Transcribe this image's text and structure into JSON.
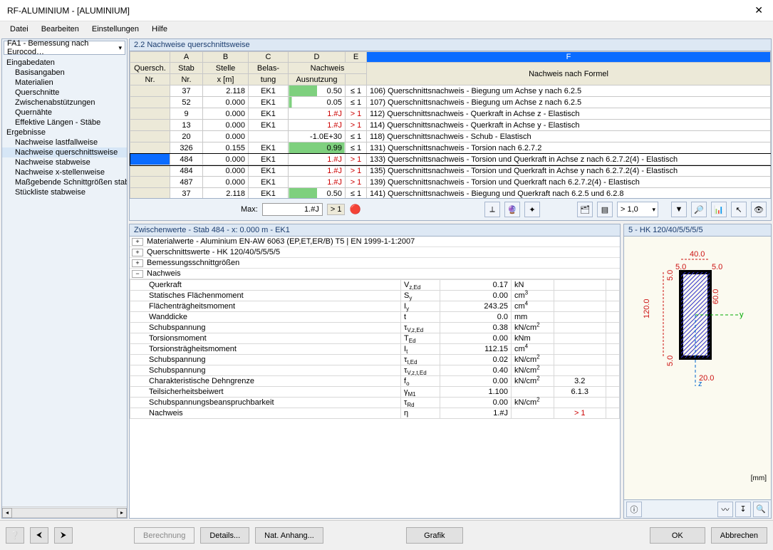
{
  "title": "RF-ALUMINIUM - [ALUMINIUM]",
  "menu": [
    "Datei",
    "Bearbeiten",
    "Einstellungen",
    "Hilfe"
  ],
  "left_dropdown": "FA1 - Bemessung nach Eurocod…",
  "tree": {
    "g1": "Eingabedaten",
    "g1_items": [
      "Basisangaben",
      "Materialien",
      "Querschnitte",
      "Zwischenabstützungen",
      "Quernähte",
      "Effektive Längen - Stäbe"
    ],
    "g2": "Ergebnisse",
    "g2_items": [
      "Nachweise lastfallweise",
      "Nachweise querschnittsweise",
      "Nachweise stabweise",
      "Nachweise x-stellenweise",
      "Maßgebende Schnittgrößen stabweise",
      "Stückliste stabweise"
    ],
    "selected": "Nachweise querschnittsweise"
  },
  "section_title": "2.2 Nachweise querschnittsweise",
  "grid": {
    "letters": [
      "",
      "A",
      "B",
      "C",
      "D",
      "E",
      "F"
    ],
    "headers_l1": [
      "Quersch.",
      "Stab",
      "Stelle",
      "Belas-",
      "Nachweis",
      "",
      "Nachweis nach Formel"
    ],
    "headers_l2": [
      "Nr.",
      "Nr.",
      "x [m]",
      "tung",
      "Ausnutzung",
      "",
      ""
    ],
    "rows": [
      {
        "a": "37",
        "b": "2.118",
        "c": "EK1",
        "d": "0.50",
        "dcls": "prog",
        "e": "≤ 1",
        "f": "106) Querschnittsnachweis - Biegung um Achse y nach 6.2.5"
      },
      {
        "a": "52",
        "b": "0.000",
        "c": "EK1",
        "d": "0.05",
        "dcls": "prog-tiny",
        "e": "≤ 1",
        "f": "107) Querschnittsnachweis - Biegung um Achse z nach 6.2.5"
      },
      {
        "a": "9",
        "b": "0.000",
        "c": "EK1",
        "d": "1.#J",
        "dcls": "red",
        "e": "> 1",
        "ecls": "red",
        "f": "112) Querschnittsnachweis - Querkraft in Achse z - Elastisch"
      },
      {
        "a": "13",
        "b": "0.000",
        "c": "EK1",
        "d": "1.#J",
        "dcls": "red",
        "e": "> 1",
        "ecls": "red",
        "f": "114) Querschnittsnachweis - Querkraft in Achse y - Elastisch"
      },
      {
        "a": "20",
        "b": "0.000",
        "c": "",
        "d": "-1.0E+30",
        "dcls": "",
        "e": "≤ 1",
        "f": "118) Querschnittsnachweis - Schub - Elastisch"
      },
      {
        "a": "326",
        "b": "0.155",
        "c": "EK1",
        "d": "0.99",
        "dcls": "prog-near",
        "e": "≤ 1",
        "f": "131) Querschnittsnachweis - Torsion nach 6.2.7.2"
      },
      {
        "a": "484",
        "b": "0.000",
        "c": "EK1",
        "d": "1.#J",
        "dcls": "red",
        "e": "> 1",
        "ecls": "red",
        "f": "133) Querschnittsnachweis - Torsion und Querkraft in Achse z nach 6.2.7.2(4) - Elastisch",
        "sel": true
      },
      {
        "a": "484",
        "b": "0.000",
        "c": "EK1",
        "d": "1.#J",
        "dcls": "red",
        "e": "> 1",
        "ecls": "red",
        "f": "135) Querschnittsnachweis - Torsion und Querkraft in Achse y nach 6.2.7.2(4) - Elastisch"
      },
      {
        "a": "487",
        "b": "0.000",
        "c": "EK1",
        "d": "1.#J",
        "dcls": "red",
        "e": "> 1",
        "ecls": "red",
        "f": "139) Querschnittsnachweis - Torsion und Querkraft nach 6.2.7.2(4) - Elastisch"
      },
      {
        "a": "37",
        "b": "2.118",
        "c": "EK1",
        "d": "0.50",
        "dcls": "prog",
        "e": "≤ 1",
        "f": "141) Querschnittsnachweis - Biegung und Querkraft nach 6.2.5 und 6.2.8"
      }
    ]
  },
  "max_label": "Max:",
  "max_value": "1.#J",
  "max_cmp": "> 1",
  "ratio_sel": "> 1,0",
  "detail_title": "Zwischenwerte - Stab 484 - x: 0.000 m - EK1",
  "detail_lines": [
    "Materialwerte - Aluminium EN-AW 6063 (EP,ET,ER/B) T5 | EN 1999-1-1:2007",
    "Querschnittswerte -  HK 120/40/5/5/5/5",
    "Bemessungsschnittgrößen",
    "Nachweis"
  ],
  "kv": [
    {
      "n": "Querkraft",
      "s": "V<sub>z,Ed</sub>",
      "v": "0.17",
      "u": "kN"
    },
    {
      "n": "Statisches Flächenmoment",
      "s": "S<sub>y</sub>",
      "v": "0.00",
      "u": "cm<sup>3</sup>"
    },
    {
      "n": "Flächenträgheitsmoment",
      "s": "I<sub>y</sub>",
      "v": "243.25",
      "u": "cm<sup>4</sup>"
    },
    {
      "n": "Wanddicke",
      "s": "t",
      "v": "0.0",
      "u": "mm"
    },
    {
      "n": "Schubspannung",
      "s": "τ<sub>V,z,Ed</sub>",
      "v": "0.38",
      "u": "kN/cm<sup>2</sup>"
    },
    {
      "n": "Torsionsmoment",
      "s": "T<sub>Ed</sub>",
      "v": "0.00",
      "u": "kNm"
    },
    {
      "n": "Torsionsträgheitsmoment",
      "s": "I<sub>t</sub>",
      "v": "112.15",
      "u": "cm<sup>4</sup>"
    },
    {
      "n": "Schubspannung",
      "s": "τ<sub>t,Ed</sub>",
      "v": "0.02",
      "u": "kN/cm<sup>2</sup>"
    },
    {
      "n": "Schubspannung",
      "s": "τ<sub>V,z,t,Ed</sub>",
      "v": "0.40",
      "u": "kN/cm<sup>2</sup>"
    },
    {
      "n": "Charakteristische Dehngrenze",
      "s": "f<sub>o</sub>",
      "v": "0.00",
      "u": "kN/cm<sup>2</sup>",
      "note": "3.2"
    },
    {
      "n": "Teilsicherheitsbeiwert",
      "s": "γ<sub>M1</sub>",
      "v": "1.100",
      "u": "",
      "note": "6.1.3"
    },
    {
      "n": "Schubspannungsbeanspruchbarkeit",
      "s": "τ<sub>Rd</sub>",
      "v": "0.00",
      "u": "kN/cm<sup>2</sup>"
    },
    {
      "n": "Nachweis",
      "s": "η",
      "v": "1.#J",
      "u": "",
      "note": "> 1",
      "notecls": "red"
    }
  ],
  "cross_title": "5 - HK 120/40/5/5/5/5",
  "mm": "[mm]",
  "footer": {
    "calc": "Berechnung",
    "details": "Details...",
    "nat": "Nat. Anhang...",
    "grafik": "Grafik",
    "ok": "OK",
    "cancel": "Abbrechen"
  }
}
